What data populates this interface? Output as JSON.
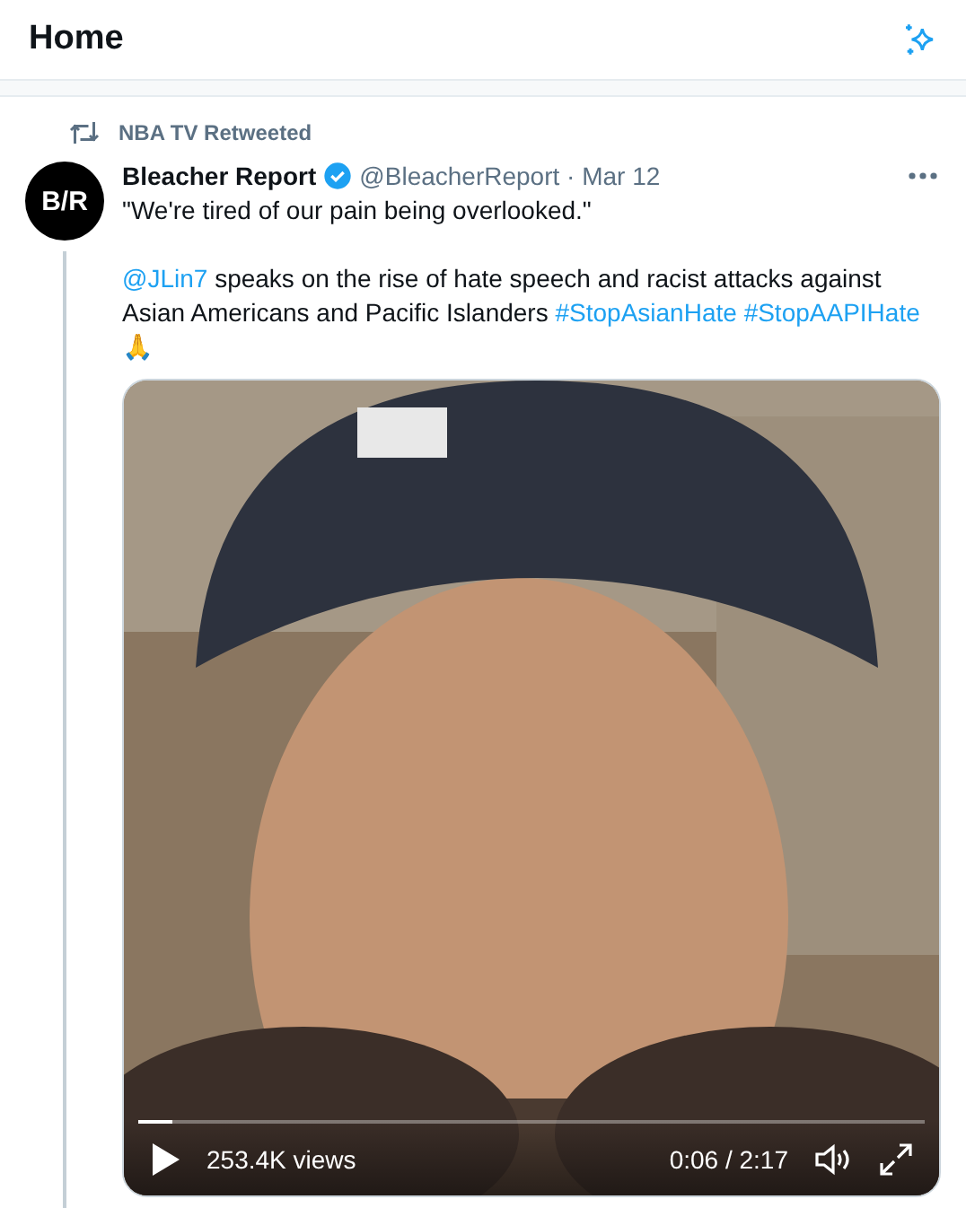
{
  "header": {
    "title": "Home"
  },
  "tweet": {
    "context": "NBA TV Retweeted",
    "author": {
      "name": "Bleacher Report",
      "verified": true,
      "handle": "@BleacherReport",
      "separator": "·",
      "date": "Mar 12"
    },
    "avatar_text": "B/R",
    "quote": "\"We're tired of our pain being overlooked.\"",
    "body": [
      {
        "kind": "link",
        "text": "@JLin7"
      },
      {
        "kind": "text",
        "text": "speaks on the rise of hate speech and racist attacks against Asian Americans and Pacific Islanders"
      },
      {
        "kind": "link",
        "text": "#StopAsianHate"
      },
      {
        "kind": "link",
        "text": "#StopAAPIHate"
      }
    ],
    "emoji": "🙏",
    "video": {
      "playing": false,
      "level": 0.044,
      "views": "253.4K views",
      "time": "0:06 / 2:17",
      "muted": false
    }
  }
}
